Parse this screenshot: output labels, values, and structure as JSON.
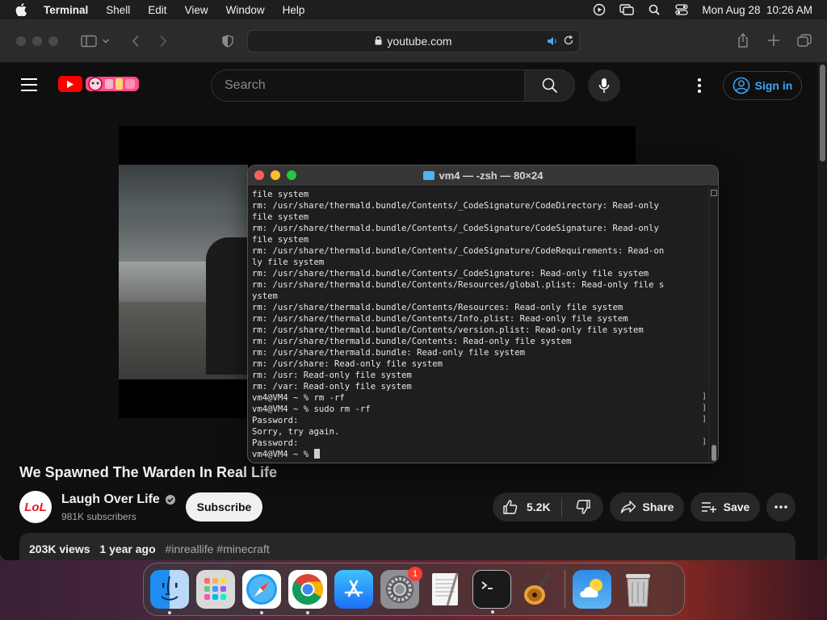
{
  "menubar": {
    "app": "Terminal",
    "items": [
      "Shell",
      "Edit",
      "View",
      "Window",
      "Help"
    ],
    "clock": "Mon Aug 28  10:26 AM"
  },
  "browser": {
    "url": "youtube.com"
  },
  "youtube": {
    "search_placeholder": "Search",
    "signin_label": "Sign in",
    "video_title": "We Spawned The Warden In Real Life",
    "channel_name": "Laugh Over Life",
    "channel_avatar_text": "LoL",
    "subscribers": "981K subscribers",
    "subscribe_label": "Subscribe",
    "likes": "5.2K",
    "share_label": "Share",
    "save_label": "Save",
    "views": "203K views",
    "uploaded": "1 year ago",
    "tags": "#inreallife #minecraft"
  },
  "terminal": {
    "title": "vm4 — -zsh — 80×24",
    "lines": [
      "file system",
      "rm: /usr/share/thermald.bundle/Contents/_CodeSignature/CodeDirectory: Read-only",
      "file system",
      "rm: /usr/share/thermald.bundle/Contents/_CodeSignature/CodeSignature: Read-only",
      "file system",
      "rm: /usr/share/thermald.bundle/Contents/_CodeSignature/CodeRequirements: Read-on",
      "ly file system",
      "rm: /usr/share/thermald.bundle/Contents/_CodeSignature: Read-only file system",
      "rm: /usr/share/thermald.bundle/Contents/Resources/global.plist: Read-only file s",
      "ystem",
      "rm: /usr/share/thermald.bundle/Contents/Resources: Read-only file system",
      "rm: /usr/share/thermald.bundle/Contents/Info.plist: Read-only file system",
      "rm: /usr/share/thermald.bundle/Contents/version.plist: Read-only file system",
      "rm: /usr/share/thermald.bundle/Contents: Read-only file system",
      "rm: /usr/share/thermald.bundle: Read-only file system",
      "rm: /usr/share: Read-only file system",
      "rm: /usr: Read-only file system",
      "rm: /var: Read-only file system",
      "vm4@VM4 ~ % rm -rf",
      "vm4@VM4 ~ % sudo rm -rf",
      "Password:",
      "Sorry, try again.",
      "Password:",
      "vm4@VM4 ~ % "
    ]
  },
  "dock": {
    "apps": [
      "Finder",
      "Launchpad",
      "Safari",
      "Chrome",
      "App Store",
      "System Settings",
      "TextEdit",
      "Terminal",
      "GarageBand",
      "Weather",
      "Trash"
    ],
    "settings_badge": "1"
  },
  "colors": {
    "yt_red": "#ff0000",
    "yt_link_blue": "#3ea6ff",
    "terminal_bg": "#1e1e1e"
  }
}
